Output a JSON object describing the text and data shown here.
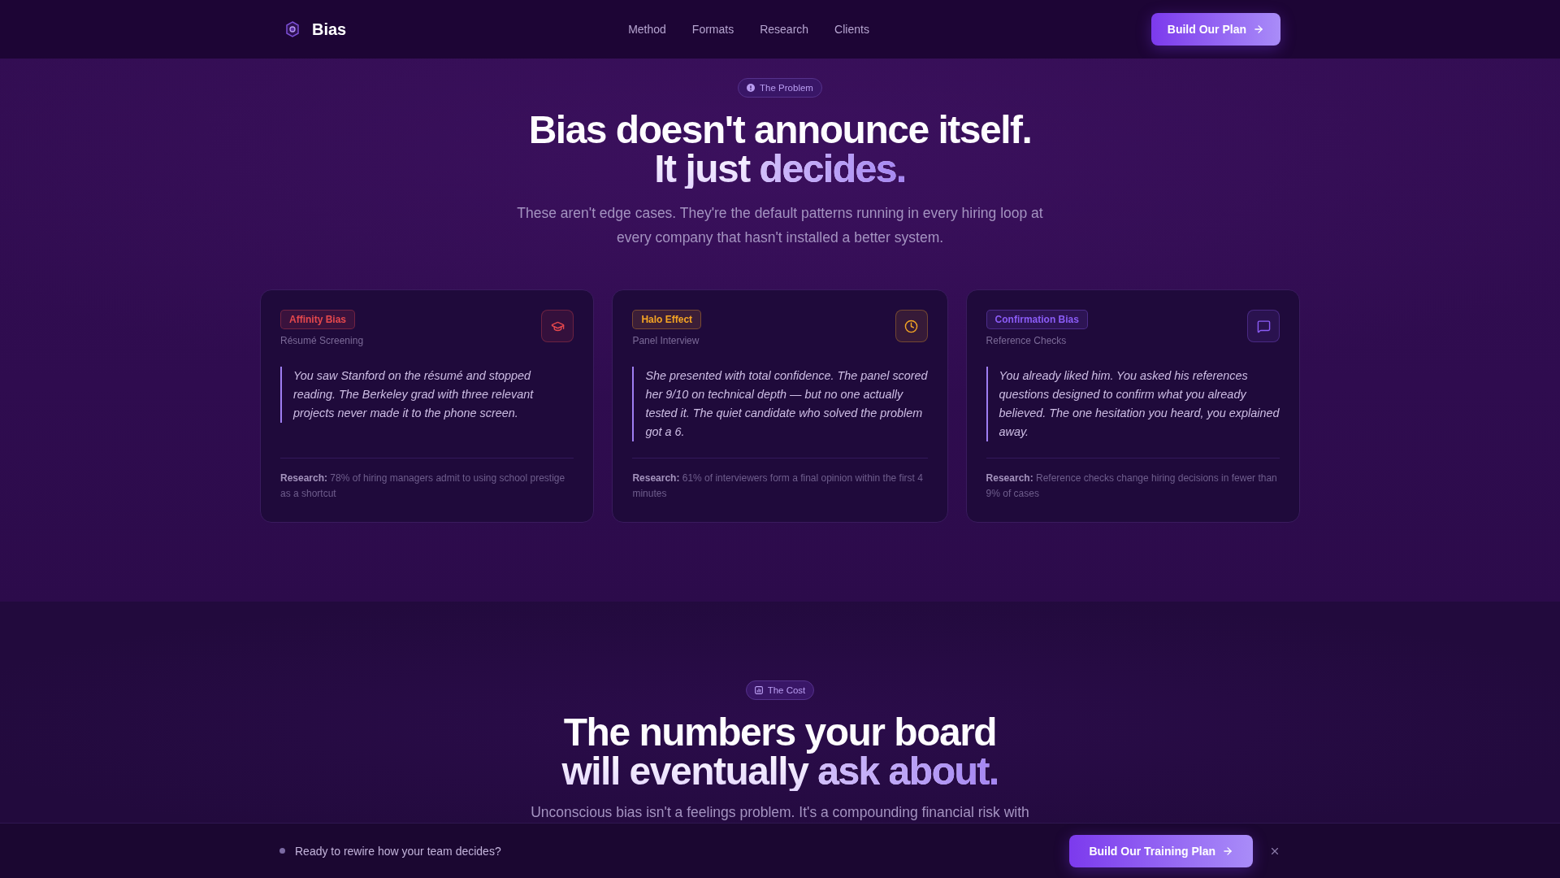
{
  "nav": {
    "brand": "Bias",
    "links": [
      "Method",
      "Formats",
      "Research",
      "Clients"
    ],
    "cta": "Build Our Plan"
  },
  "problem": {
    "badge": "The Problem",
    "heading": {
      "lines": [
        "Bias doesn't announce itself.",
        "It just"
      ],
      "highlight": "decides."
    },
    "subtitle": "These aren't edge cases. They're the default patterns running in every hiring loop at every company that hasn't installed a better system.",
    "cards": [
      {
        "tag": "Affinity Bias",
        "color": "#e5484d",
        "stage": "Résumé Screening",
        "quote_lines": [
          "You saw Stanford on the résumé and stopped",
          "reading. The Berkeley grad with three relevant",
          "projects never made it to the phone screen."
        ],
        "research": "**Research:** 78% of hiring managers admit to using school prestige as a shortcut"
      },
      {
        "tag": "Halo Effect",
        "color": "#f5a524",
        "stage": "Panel Interview",
        "quote_lines": [
          "She presented with total confidence. The panel scored",
          "her 9/10 on technical depth — but no one actually",
          "tested it. The quiet candidate who solved the problem",
          "got a 6."
        ],
        "research": "**Research:** 61% of interviewers form a final opinion within the first 4 minutes"
      },
      {
        "tag": "Confirmation Bias",
        "color": "#8b5cf6",
        "stage": "Reference Checks",
        "quote_lines": [
          "You already liked him. You asked his references",
          "questions designed to confirm what you already",
          "believed. The one hesitation you heard, you explained",
          "away."
        ],
        "research": "**Research:** Reference checks change hiring decisions in fewer than 9% of cases"
      }
    ]
  },
  "cost": {
    "badge": "The Cost",
    "heading": {
      "lines": [
        "The numbers your board",
        "will eventually"
      ],
      "highlight": "ask about."
    },
    "subtitle": "Unconscious bias isn't a feelings problem. It's a compounding financial risk with"
  },
  "bottom_bar": {
    "message": "Ready to rewire how your team decides?",
    "cta": "Build Our Training Plan"
  }
}
